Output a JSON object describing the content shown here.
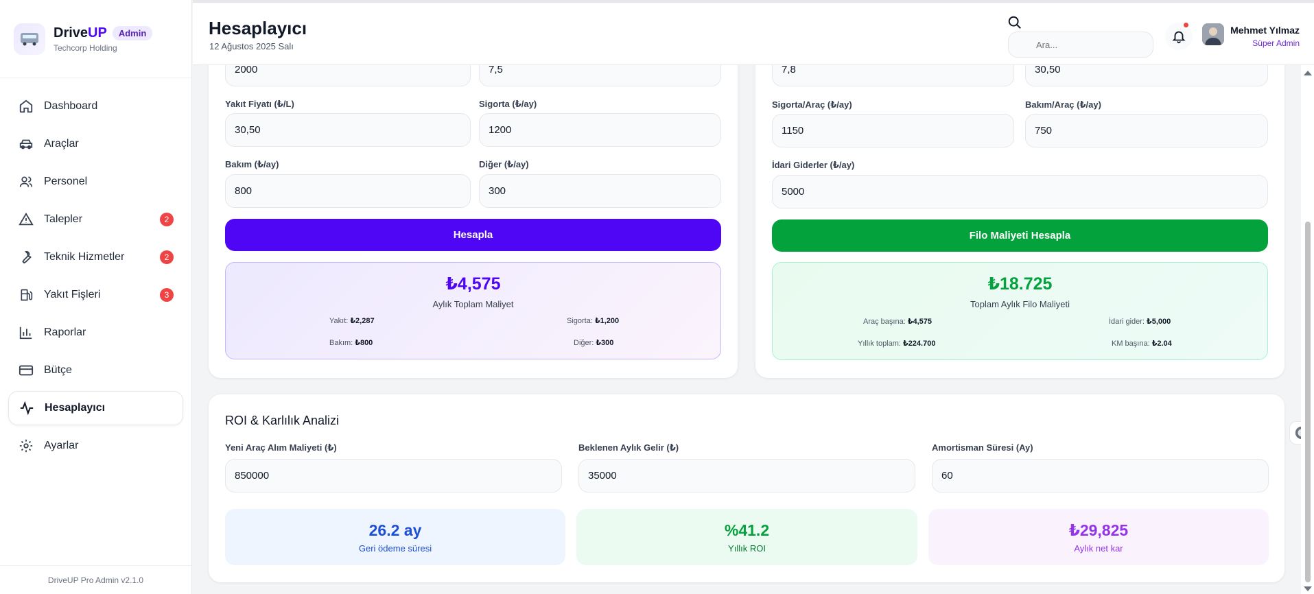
{
  "brand": {
    "name_prefix": "Drive",
    "name_suffix": "UP",
    "badge": "Admin",
    "company": "Techcorp Holding"
  },
  "sidebar": {
    "items": [
      {
        "label": "Dashboard",
        "icon": "home-icon",
        "badge": null
      },
      {
        "label": "Araçlar",
        "icon": "car-icon",
        "badge": null
      },
      {
        "label": "Personel",
        "icon": "users-icon",
        "badge": null
      },
      {
        "label": "Talepler",
        "icon": "alert-triangle-icon",
        "badge": "2"
      },
      {
        "label": "Teknik Hizmetler",
        "icon": "wrench-icon",
        "badge": "2"
      },
      {
        "label": "Yakıt Fişleri",
        "icon": "fuel-icon",
        "badge": "3"
      },
      {
        "label": "Raporlar",
        "icon": "bar-chart-icon",
        "badge": null
      },
      {
        "label": "Bütçe",
        "icon": "wallet-icon",
        "badge": null
      },
      {
        "label": "Hesaplayıcı",
        "icon": "activity-icon",
        "badge": null
      },
      {
        "label": "Ayarlar",
        "icon": "gear-icon",
        "badge": null
      }
    ],
    "active_index": 8,
    "footer": "DriveUP Pro Admin v2.1.0"
  },
  "header": {
    "title": "Hesaplayıcı",
    "date": "12 Ağustos 2025 Salı",
    "search_placeholder": "Ara...",
    "user_name": "Mehmet Yılmaz",
    "user_role": "Süper Admin"
  },
  "vehicle_calc": {
    "top_left_value": "2000",
    "top_right_value": "7,5",
    "fuel_price_label": "Yakıt Fiyatı (₺/L)",
    "fuel_price_value": "30,50",
    "insurance_label": "Sigorta (₺/ay)",
    "insurance_value": "1200",
    "maintenance_label": "Bakım (₺/ay)",
    "maintenance_value": "800",
    "other_label": "Diğer (₺/ay)",
    "other_value": "300",
    "button": "Hesapla",
    "result_total": "₺4,575",
    "result_label": "Aylık Toplam Maliyet",
    "breakdown": {
      "fuel_label": "Yakıt:",
      "fuel_value": "₺2,287",
      "insurance_label": "Sigorta:",
      "insurance_value": "₺1,200",
      "maintenance_label": "Bakım:",
      "maintenance_value": "₺800",
      "other_label": "Diğer:",
      "other_value": "₺300"
    }
  },
  "fleet_calc": {
    "top_left_value": "7,8",
    "top_right_value": "30,50",
    "insurance_label": "Sigorta/Araç (₺/ay)",
    "insurance_value": "1150",
    "maintenance_label": "Bakım/Araç (₺/ay)",
    "maintenance_value": "750",
    "admin_label": "İdari Giderler (₺/ay)",
    "admin_value": "5000",
    "button": "Filo Maliyeti Hesapla",
    "result_total": "₺18.725",
    "result_label": "Toplam Aylık Filo Maliyeti",
    "breakdown": {
      "per_vehicle_label": "Araç başına:",
      "per_vehicle_value": "₺4,575",
      "admin_label": "İdari gider:",
      "admin_value": "₺5,000",
      "yearly_label": "Yıllık toplam:",
      "yearly_value": "₺224.700",
      "per_km_label": "KM başına:",
      "per_km_value": "₺2.04"
    }
  },
  "roi": {
    "title": "ROI & Karlılık Analizi",
    "purchase_label": "Yeni Araç Alım Maliyeti (₺)",
    "purchase_value": "850000",
    "income_label": "Beklenen Aylık Gelir (₺)",
    "income_value": "35000",
    "depreciation_label": "Amortisman Süresi (Ay)",
    "depreciation_value": "60",
    "metrics": [
      {
        "value": "26.2 ay",
        "label": "Geri ödeme süresi"
      },
      {
        "value": "%41.2",
        "label": "Yıllık ROI"
      },
      {
        "value": "₺29,825",
        "label": "Aylık net kar"
      }
    ]
  },
  "colors": {
    "brand_purple": "#4f06f5",
    "success_green": "#04a23c",
    "blue_metric": "#1d4ed8",
    "purple_metric": "#9333ea",
    "badge_red": "#ef4444"
  }
}
